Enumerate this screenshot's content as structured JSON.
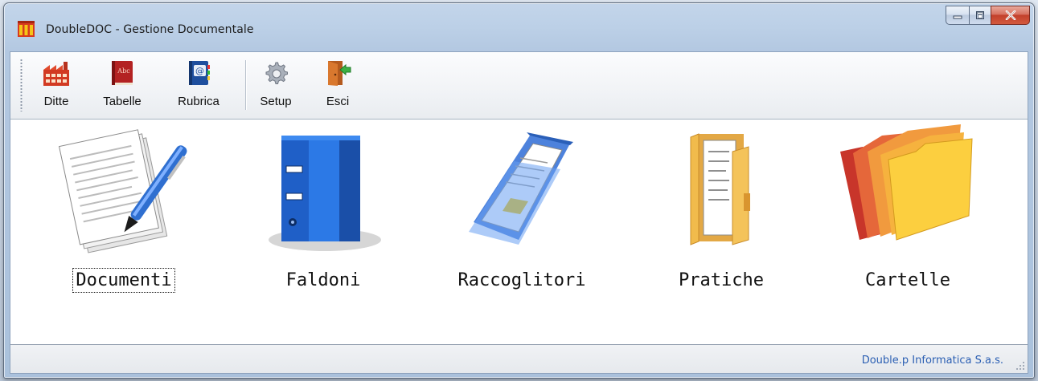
{
  "window": {
    "title": "DoubleDOC - Gestione Documentale",
    "controls": {
      "minimize": "minimize-icon",
      "maximize": "maximize-icon",
      "close": "close-icon"
    }
  },
  "toolbar": {
    "items": [
      {
        "label": "Ditte",
        "icon": "factory-icon"
      },
      {
        "label": "Tabelle",
        "icon": "book-icon"
      },
      {
        "label": "Rubrica",
        "icon": "address-book-icon"
      },
      {
        "label": "Setup",
        "icon": "gear-icon"
      },
      {
        "label": "Esci",
        "icon": "exit-door-icon"
      }
    ]
  },
  "main": {
    "items": [
      {
        "label": "Documenti",
        "icon": "documents-pen-icon",
        "focused": true
      },
      {
        "label": "Faldoni",
        "icon": "blue-binder-icon",
        "focused": false
      },
      {
        "label": "Raccoglitori",
        "icon": "document-sleeve-icon",
        "focused": false
      },
      {
        "label": "Pratiche",
        "icon": "folder-documents-icon",
        "focused": false
      },
      {
        "label": "Cartelle",
        "icon": "stacked-folders-icon",
        "focused": false
      }
    ]
  },
  "statusbar": {
    "text": "Double.p Informatica S.a.s."
  },
  "colors": {
    "status_text": "#2b5fb3",
    "close_button": "#c2402b"
  }
}
